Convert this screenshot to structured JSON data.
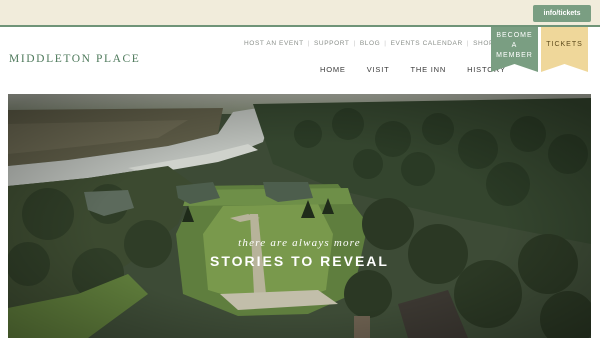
{
  "topbar": {
    "info_label": "info/tickets"
  },
  "header": {
    "logo": "MIDDLETON PLACE",
    "utility_nav": [
      "HOST AN EVENT",
      "SUPPORT",
      "BLOG",
      "EVENTS CALENDAR",
      "SHOP"
    ],
    "main_nav": [
      "HOME",
      "VISIT",
      "THE INN",
      "HISTORY"
    ],
    "member_banner": [
      "BECOME",
      "A",
      "MEMBER"
    ],
    "tickets_banner": "TICKETS"
  },
  "hero": {
    "tagline_small": "there are always more",
    "tagline_large": "STORIES TO REVEAL"
  },
  "colors": {
    "topbar_bg": "#f1ecdb",
    "accent_green": "#7a9e82",
    "tickets_gold": "#efd79a",
    "logo_green": "#4f7a5c"
  }
}
